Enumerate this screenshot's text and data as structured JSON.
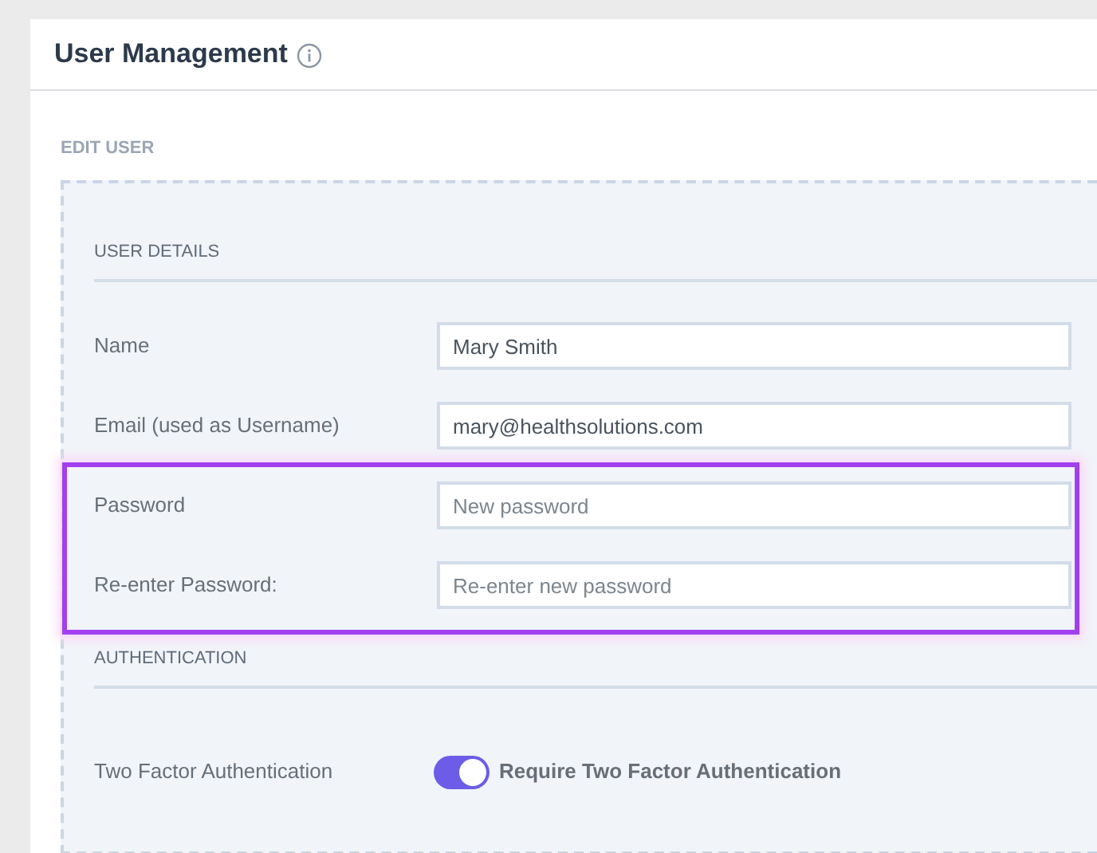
{
  "header": {
    "title": "User Management"
  },
  "form": {
    "title": "EDIT USER",
    "sections": [
      {
        "title": "USER DETAILS",
        "rows": [
          {
            "kind": "field",
            "label": "Name",
            "value": "Mary Smith",
            "highlighted": false
          },
          {
            "kind": "field",
            "label": "Email (used as Username)",
            "value": "mary@healthsolutions.com",
            "highlighted": false
          },
          {
            "kind": "field",
            "label": "Password",
            "placeholder": "New password",
            "highlighted": true
          },
          {
            "kind": "field",
            "label": "Re-enter Password:",
            "placeholder": "Re-enter new password",
            "highlighted": true
          }
        ]
      },
      {
        "title": "AUTHENTICATION",
        "rows": [
          {
            "kind": "toggle",
            "label": "Two Factor Authentication",
            "text": "Require Two Factor Authentication",
            "on": true,
            "highlighted": false
          }
        ]
      }
    ]
  }
}
